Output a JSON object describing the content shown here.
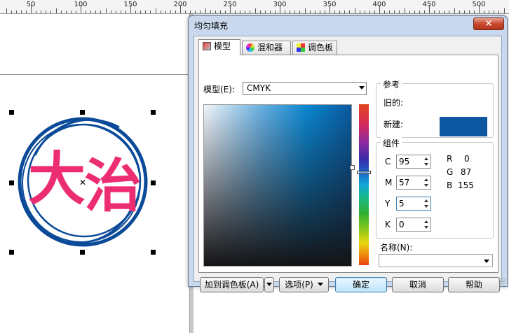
{
  "ruler": {
    "labels": [
      "50",
      "100",
      "150",
      "200",
      "250",
      "300",
      "350",
      "400",
      "450",
      "500"
    ]
  },
  "logo": {
    "characters": [
      "大",
      "治"
    ],
    "text_color": "#ed2d72",
    "ring_color": "#0a4a98"
  },
  "dialog": {
    "title": "均匀填充",
    "close_symbol": "✕",
    "tabs": [
      {
        "label": "模型",
        "icon": "model-icon"
      },
      {
        "label": "混和器",
        "icon": "mixer-icon"
      },
      {
        "label": "调色板",
        "icon": "palette-icon"
      }
    ],
    "model": {
      "label": "模型(E):",
      "value": "CMYK"
    },
    "reference": {
      "legend": "参考",
      "old_label": "旧的:",
      "new_label": "新建:",
      "new_color": "#0c57a0"
    },
    "components": {
      "legend": "组件",
      "cmyk": [
        {
          "label": "C",
          "value": "95"
        },
        {
          "label": "M",
          "value": "57"
        },
        {
          "label": "Y",
          "value": "5"
        },
        {
          "label": "K",
          "value": "0"
        }
      ],
      "rgb": [
        {
          "label": "R",
          "value": "0"
        },
        {
          "label": "G",
          "value": "87"
        },
        {
          "label": "B",
          "value": "155"
        }
      ]
    },
    "name": {
      "label": "名称(N):",
      "value": ""
    },
    "buttons": {
      "add_to_palette": "加到调色板(A)",
      "options": "选项(P)",
      "ok": "确定",
      "cancel": "取消",
      "help": "帮助"
    }
  }
}
